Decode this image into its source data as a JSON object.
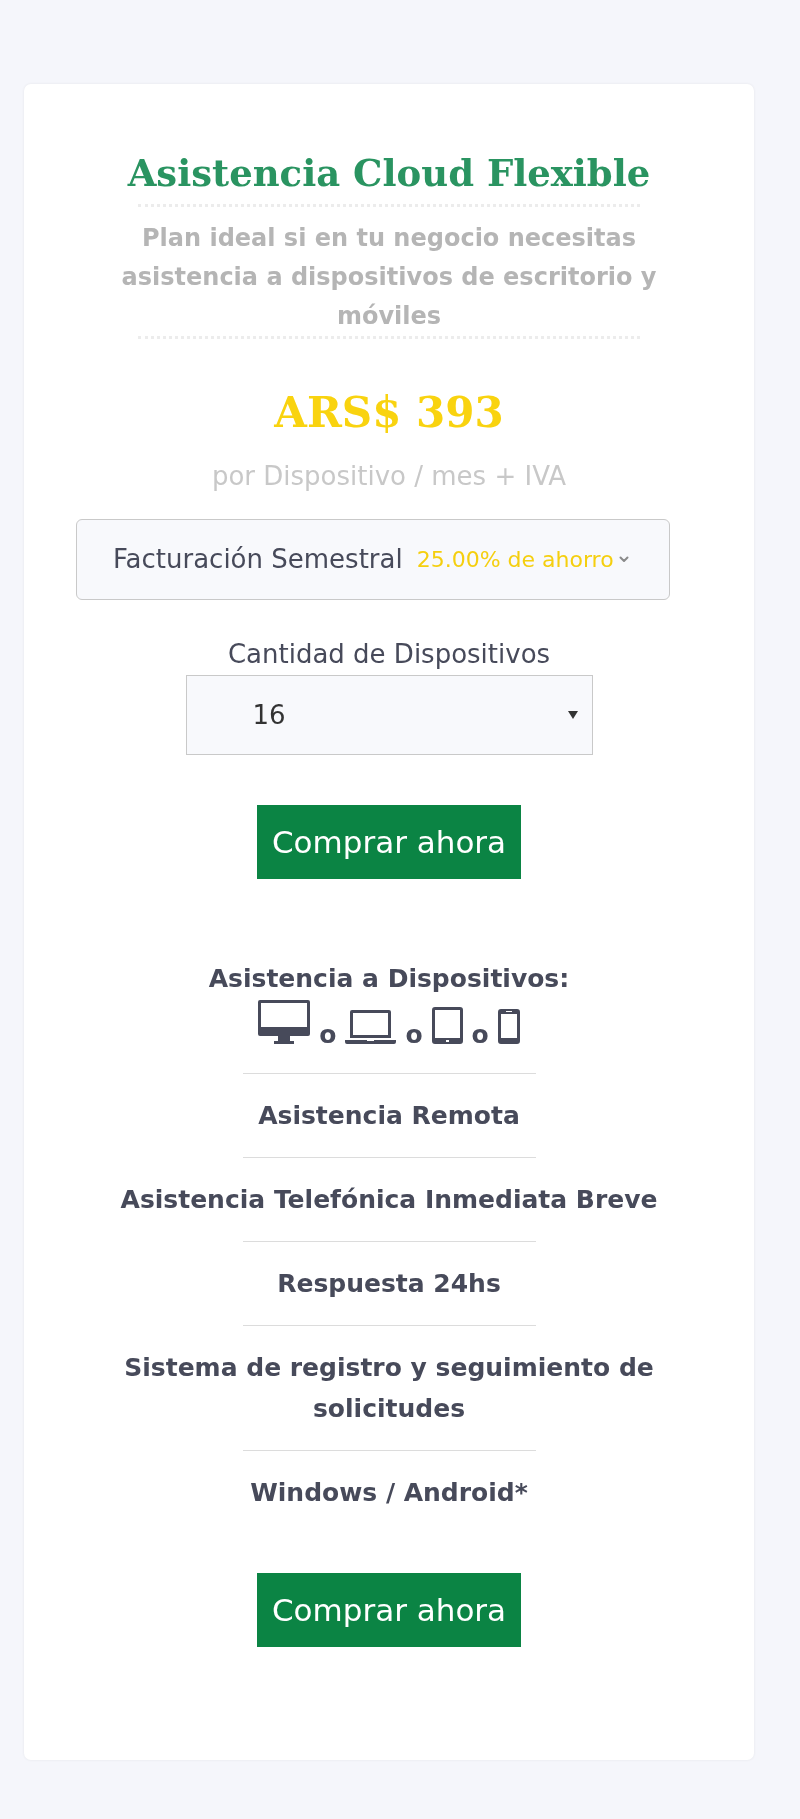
{
  "plan": {
    "title": "Asistencia Cloud Flexible",
    "description": "Plan ideal si en tu negocio necesitas asistencia a dispositivos de escritorio y móviles",
    "price": "ARS$ 393",
    "price_unit": "por Dispositivo / mes + IVA"
  },
  "billing": {
    "value": "Facturación Semestral",
    "savings": "25.00% de ahorro"
  },
  "device_count": {
    "label": "Cantidad de Dispositivos",
    "value": "16"
  },
  "buy_button_top": {
    "label": "Comprar ahora"
  },
  "features": [
    {
      "kind": "devices",
      "text": "Asistencia a Dispositivos:",
      "separators": [
        "o",
        "o",
        "o"
      ]
    },
    {
      "kind": "text",
      "text": "Asistencia Remota"
    },
    {
      "kind": "text",
      "text": "Asistencia Telefónica Inmediata Breve"
    },
    {
      "kind": "text",
      "text": "Respuesta 24hs"
    },
    {
      "kind": "text",
      "text": "Sistema de registro y seguimiento de solicitudes"
    },
    {
      "kind": "text",
      "text": "Windows / Android*"
    }
  ],
  "buy_button_bottom": {
    "label": "Comprar ahora"
  }
}
